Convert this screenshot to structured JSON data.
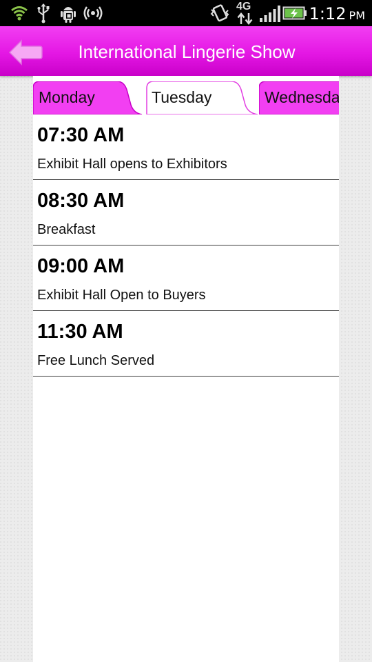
{
  "status_bar": {
    "time": "1:12",
    "ampm": "PM",
    "network_label": "4G"
  },
  "header": {
    "title": "International Lingerie Show"
  },
  "tabs": [
    {
      "label": "Monday",
      "selected": false
    },
    {
      "label": "Tuesday",
      "selected": true
    },
    {
      "label": "Wednesday",
      "selected": false
    }
  ],
  "schedule": [
    {
      "time": "07:30 AM",
      "title": "Exhibit Hall opens to Exhibitors"
    },
    {
      "time": "08:30 AM",
      "title": "Breakfast"
    },
    {
      "time": "09:00 AM",
      "title": "Exhibit Hall Open to Buyers"
    },
    {
      "time": "11:30 AM",
      "title": "Free Lunch Served"
    }
  ],
  "colors": {
    "accent": "#e417e4",
    "tab_unselected": "#f23ff2",
    "status_icon_green": "#8bc34a"
  },
  "icons": {
    "back": "back-arrow-icon",
    "wifi": "wifi-icon",
    "usb": "usb-icon",
    "debug": "android-debug-icon",
    "hotspot": "hotspot-icon",
    "vibrate": "vibrate-icon",
    "data": "data-transfer-icon",
    "signal": "signal-icon",
    "battery": "battery-charging-icon"
  }
}
